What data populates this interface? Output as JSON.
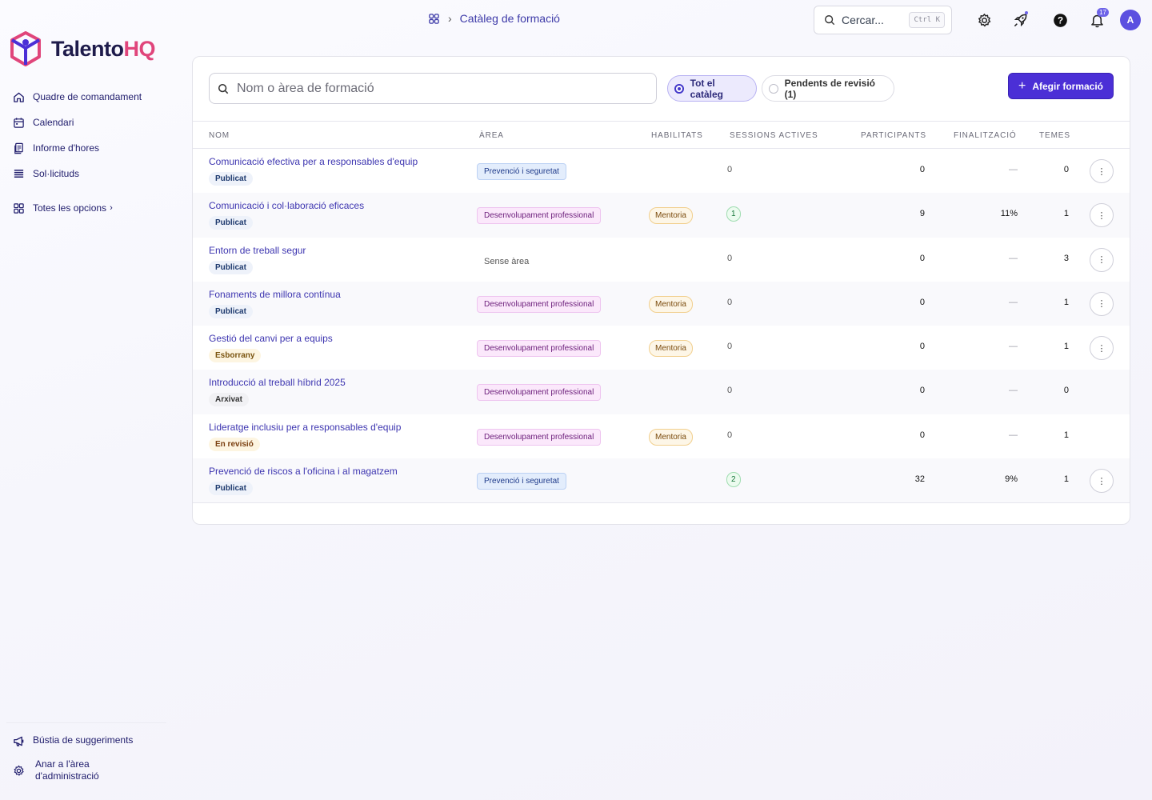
{
  "brand": {
    "name_main": "Talento",
    "name_accent": "HQ"
  },
  "sidebar": {
    "items": [
      {
        "label": "Quadre de comandament",
        "icon": "home-icon"
      },
      {
        "label": "Calendari",
        "icon": "calendar-icon"
      },
      {
        "label": "Informe d'hores",
        "icon": "report-icon"
      },
      {
        "label": "Sol·licituds",
        "icon": "list-icon"
      }
    ],
    "all_options": "Totes les opcions",
    "bottom": [
      {
        "label": "Bústia de suggeriments",
        "icon": "megaphone-icon"
      },
      {
        "label_line1": "Anar a l'àrea",
        "label_line2": "d'administració",
        "icon": "gear-icon"
      }
    ]
  },
  "topbar": {
    "breadcrumb": "Catàleg de formació",
    "search_placeholder": "Cercar...",
    "search_shortcut": "Ctrl K",
    "notifications_count": "17",
    "avatar_initial": "A"
  },
  "toolbar": {
    "filter_placeholder": "Nom o àrea de formació",
    "chip_all": "Tot el catàleg",
    "chip_pending": "Pendents de revisió (1)",
    "add_button": "Afegir formació"
  },
  "table": {
    "headers": [
      "NOM",
      "ÀREA",
      "HABILITATS",
      "SESSIONS ACTIVES",
      "PARTICIPANTS",
      "FINALITZACIÓ",
      "TEMES"
    ],
    "rows": [
      {
        "name": "Comunicació efectiva per a responsables d'equip",
        "status": "Publicat",
        "status_kind": "pub",
        "area": "Prevenció i seguretat",
        "area_kind": "prev",
        "skill": "",
        "sessions": "0",
        "sessions_pill": false,
        "participants": "0",
        "completion": "—",
        "topics": "0",
        "menu": true
      },
      {
        "name": "Comunicació i col·laboració eficaces",
        "status": "Publicat",
        "status_kind": "pub",
        "area": "Desenvolupament professional",
        "area_kind": "dev",
        "skill": "Mentoria",
        "sessions": "1",
        "sessions_pill": true,
        "participants": "9",
        "completion": "11%",
        "topics": "1",
        "menu": true
      },
      {
        "name": "Entorn de treball segur",
        "status": "Publicat",
        "status_kind": "pub",
        "area": "Sense àrea",
        "area_kind": "none",
        "skill": "",
        "sessions": "0",
        "sessions_pill": false,
        "participants": "0",
        "completion": "—",
        "topics": "3",
        "menu": true
      },
      {
        "name": "Fonaments de millora contínua",
        "status": "Publicat",
        "status_kind": "pub",
        "area": "Desenvolupament professional",
        "area_kind": "dev",
        "skill": "Mentoria",
        "sessions": "0",
        "sessions_pill": false,
        "participants": "0",
        "completion": "—",
        "topics": "1",
        "menu": true
      },
      {
        "name": "Gestió del canvi per a equips",
        "status": "Esborrany",
        "status_kind": "draft",
        "area": "Desenvolupament professional",
        "area_kind": "dev",
        "skill": "Mentoria",
        "sessions": "0",
        "sessions_pill": false,
        "participants": "0",
        "completion": "—",
        "topics": "1",
        "menu": true
      },
      {
        "name": "Introducció al treball híbrid 2025",
        "status": "Arxivat",
        "status_kind": "arch",
        "area": "Desenvolupament professional",
        "area_kind": "dev",
        "skill": "",
        "sessions": "0",
        "sessions_pill": false,
        "participants": "0",
        "completion": "—",
        "topics": "0",
        "menu": false
      },
      {
        "name": "Lideratge inclusiu per a responsables d'equip",
        "status": "En revisió",
        "status_kind": "rev",
        "area": "Desenvolupament professional",
        "area_kind": "dev",
        "skill": "Mentoria",
        "sessions": "0",
        "sessions_pill": false,
        "participants": "0",
        "completion": "—",
        "topics": "1",
        "menu": false
      },
      {
        "name": "Prevenció de riscos a l'oficina i al magatzem",
        "status": "Publicat",
        "status_kind": "pub",
        "area": "Prevenció i seguretat",
        "area_kind": "prev",
        "skill": "",
        "sessions": "2",
        "sessions_pill": true,
        "participants": "32",
        "completion": "9%",
        "topics": "1",
        "menu": true
      }
    ]
  },
  "colors": {
    "accent": "#4b2fd6",
    "brand_pink": "#e0457b",
    "link": "#3d35b0"
  }
}
